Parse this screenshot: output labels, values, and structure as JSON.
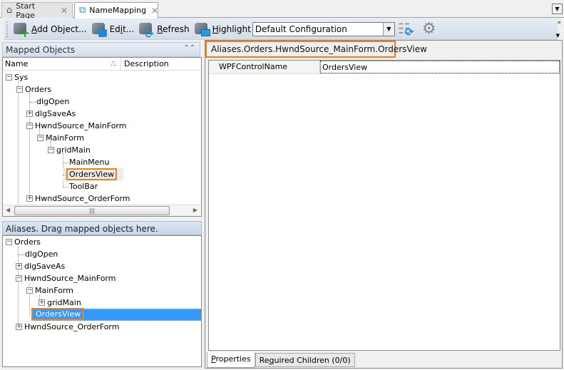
{
  "tabs": [
    {
      "label": "Start Page",
      "icon": "home-icon",
      "active": false
    },
    {
      "label": "NameMapping",
      "icon": "namemapping-icon",
      "active": true
    }
  ],
  "toolbar": {
    "add_object": {
      "prefix": "",
      "accel": "A",
      "rest": "dd Object..."
    },
    "edit": {
      "prefix": "Ed",
      "accel": "i",
      "rest": "t..."
    },
    "refresh": {
      "prefix": "",
      "accel": "R",
      "rest": "efresh"
    },
    "highlight": {
      "prefix": "",
      "accel": "H",
      "rest": "ighlight"
    },
    "configuration": "Default Configuration"
  },
  "mapped_objects": {
    "title": "Mapped Objects",
    "columns": [
      "Name",
      "Description"
    ],
    "tree": [
      {
        "label": "Sys",
        "expander": "minus",
        "level": 0
      },
      {
        "label": "Orders",
        "expander": "minus",
        "level": 1
      },
      {
        "label": "dlgOpen",
        "expander": "none",
        "level": 2
      },
      {
        "label": "dlgSaveAs",
        "expander": "plus",
        "level": 2
      },
      {
        "label": "HwndSource_MainForm",
        "expander": "minus",
        "level": 2
      },
      {
        "label": "MainForm",
        "expander": "minus",
        "level": 3
      },
      {
        "label": "gridMain",
        "expander": "minus",
        "level": 4
      },
      {
        "label": "MainMenu",
        "expander": "none",
        "level": 5
      },
      {
        "label": "OrdersView",
        "expander": "none",
        "level": 5,
        "highlighted": true
      },
      {
        "label": "ToolBar",
        "expander": "none",
        "level": 5
      },
      {
        "label": "HwndSource_OrderForm",
        "expander": "plus",
        "level": 2
      }
    ]
  },
  "aliases": {
    "title": "Aliases. Drag mapped objects here.",
    "tree": [
      {
        "label": "Orders",
        "expander": "minus",
        "level": 0
      },
      {
        "label": "dlgOpen",
        "expander": "none",
        "level": 1
      },
      {
        "label": "dlgSaveAs",
        "expander": "plus",
        "level": 1
      },
      {
        "label": "HwndSource_MainForm",
        "expander": "minus",
        "level": 1
      },
      {
        "label": "MainForm",
        "expander": "minus",
        "level": 2
      },
      {
        "label": "gridMain",
        "expander": "plus",
        "level": 3
      },
      {
        "label": "OrdersView",
        "expander": "none",
        "level": 2,
        "selected": true
      },
      {
        "label": "HwndSource_OrderForm",
        "expander": "plus",
        "level": 1
      }
    ]
  },
  "details": {
    "path": "Aliases.Orders.HwndSource_MainForm.OrdersView",
    "properties": [
      {
        "name": "WPFControlName",
        "value": "OrdersView"
      }
    ],
    "tabs": [
      {
        "prefix": "",
        "accel": "P",
        "rest": "roperties",
        "active": true
      },
      {
        "prefix": "Re",
        "accel": "q",
        "rest": "uired Children (0/0)",
        "active": false
      }
    ]
  },
  "colors": {
    "highlight_orange": "#f47e14",
    "selection_blue": "#3399ff"
  }
}
